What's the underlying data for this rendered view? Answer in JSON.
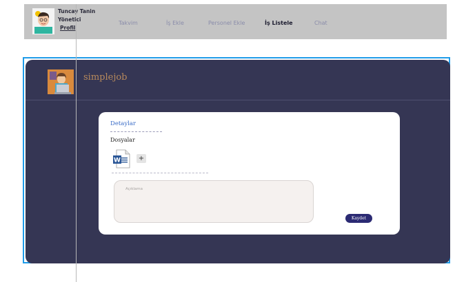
{
  "header": {
    "user_name": "Tuncay Tanin",
    "user_role": "Yönetici",
    "profile_link": "Profil",
    "nav": [
      {
        "label": "Takvim",
        "active": false
      },
      {
        "label": "İş Ekle",
        "active": false
      },
      {
        "label": "Personel Ekle",
        "active": false
      },
      {
        "label": "İş Listele",
        "active": true
      },
      {
        "label": "Chat",
        "active": false
      }
    ]
  },
  "panel": {
    "brand": "simplejob"
  },
  "card": {
    "title": "Detaylar",
    "files_label": "Dosyalar",
    "file_icon": "word-document-icon",
    "add_label": "+",
    "description_placeholder": "Açıklama",
    "save_label": "Kaydet"
  },
  "colors": {
    "nav_bg": "#c4c4c4",
    "panel_bg": "#353654",
    "selection_border": "#1e9be8",
    "save_button": "#2b2a73",
    "title_blue": "#3a6cc7",
    "brand": "#b88a5c"
  }
}
